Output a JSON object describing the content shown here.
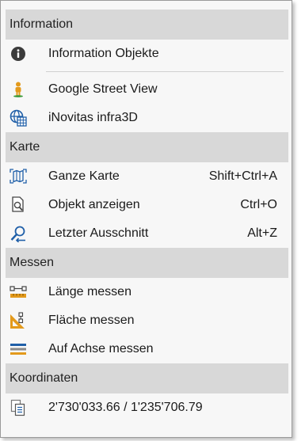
{
  "sections": {
    "information": "Information",
    "karte": "Karte",
    "messen": "Messen",
    "koordinaten": "Koordinaten"
  },
  "items": {
    "info_objekte": {
      "label": "Information Objekte",
      "icon": "info-icon"
    },
    "street_view": {
      "label": "Google Street View",
      "icon": "pegman-icon"
    },
    "inovitas": {
      "label": "iNovitas infra3D",
      "icon": "globe-grid-icon"
    },
    "ganze_karte": {
      "label": "Ganze Karte",
      "shortcut": "Shift+Ctrl+A",
      "icon": "full-map-icon"
    },
    "objekt_anzeigen": {
      "label": "Objekt anzeigen",
      "shortcut": "Ctrl+O",
      "icon": "zoom-object-icon"
    },
    "letzter_ausschnitt": {
      "label": "Letzter Ausschnitt",
      "shortcut": "Alt+Z",
      "icon": "zoom-back-icon"
    },
    "laenge_messen": {
      "label": "Länge messen",
      "icon": "measure-length-icon"
    },
    "flaeche_messen": {
      "label": "Fläche messen",
      "icon": "measure-area-icon"
    },
    "achse_messen": {
      "label": "Auf Achse messen",
      "icon": "measure-axis-icon"
    },
    "koordinaten": {
      "label": "2'730'033.66 / 1'235'706.79",
      "icon": "copy-coordinates-icon"
    }
  },
  "colors": {
    "section_bg": "#d8d8d8",
    "menu_bg": "#f7f7f7",
    "accent_blue": "#1f5fa8",
    "icon_orange": "#e39a1c",
    "icon_green": "#3a9a3a"
  }
}
